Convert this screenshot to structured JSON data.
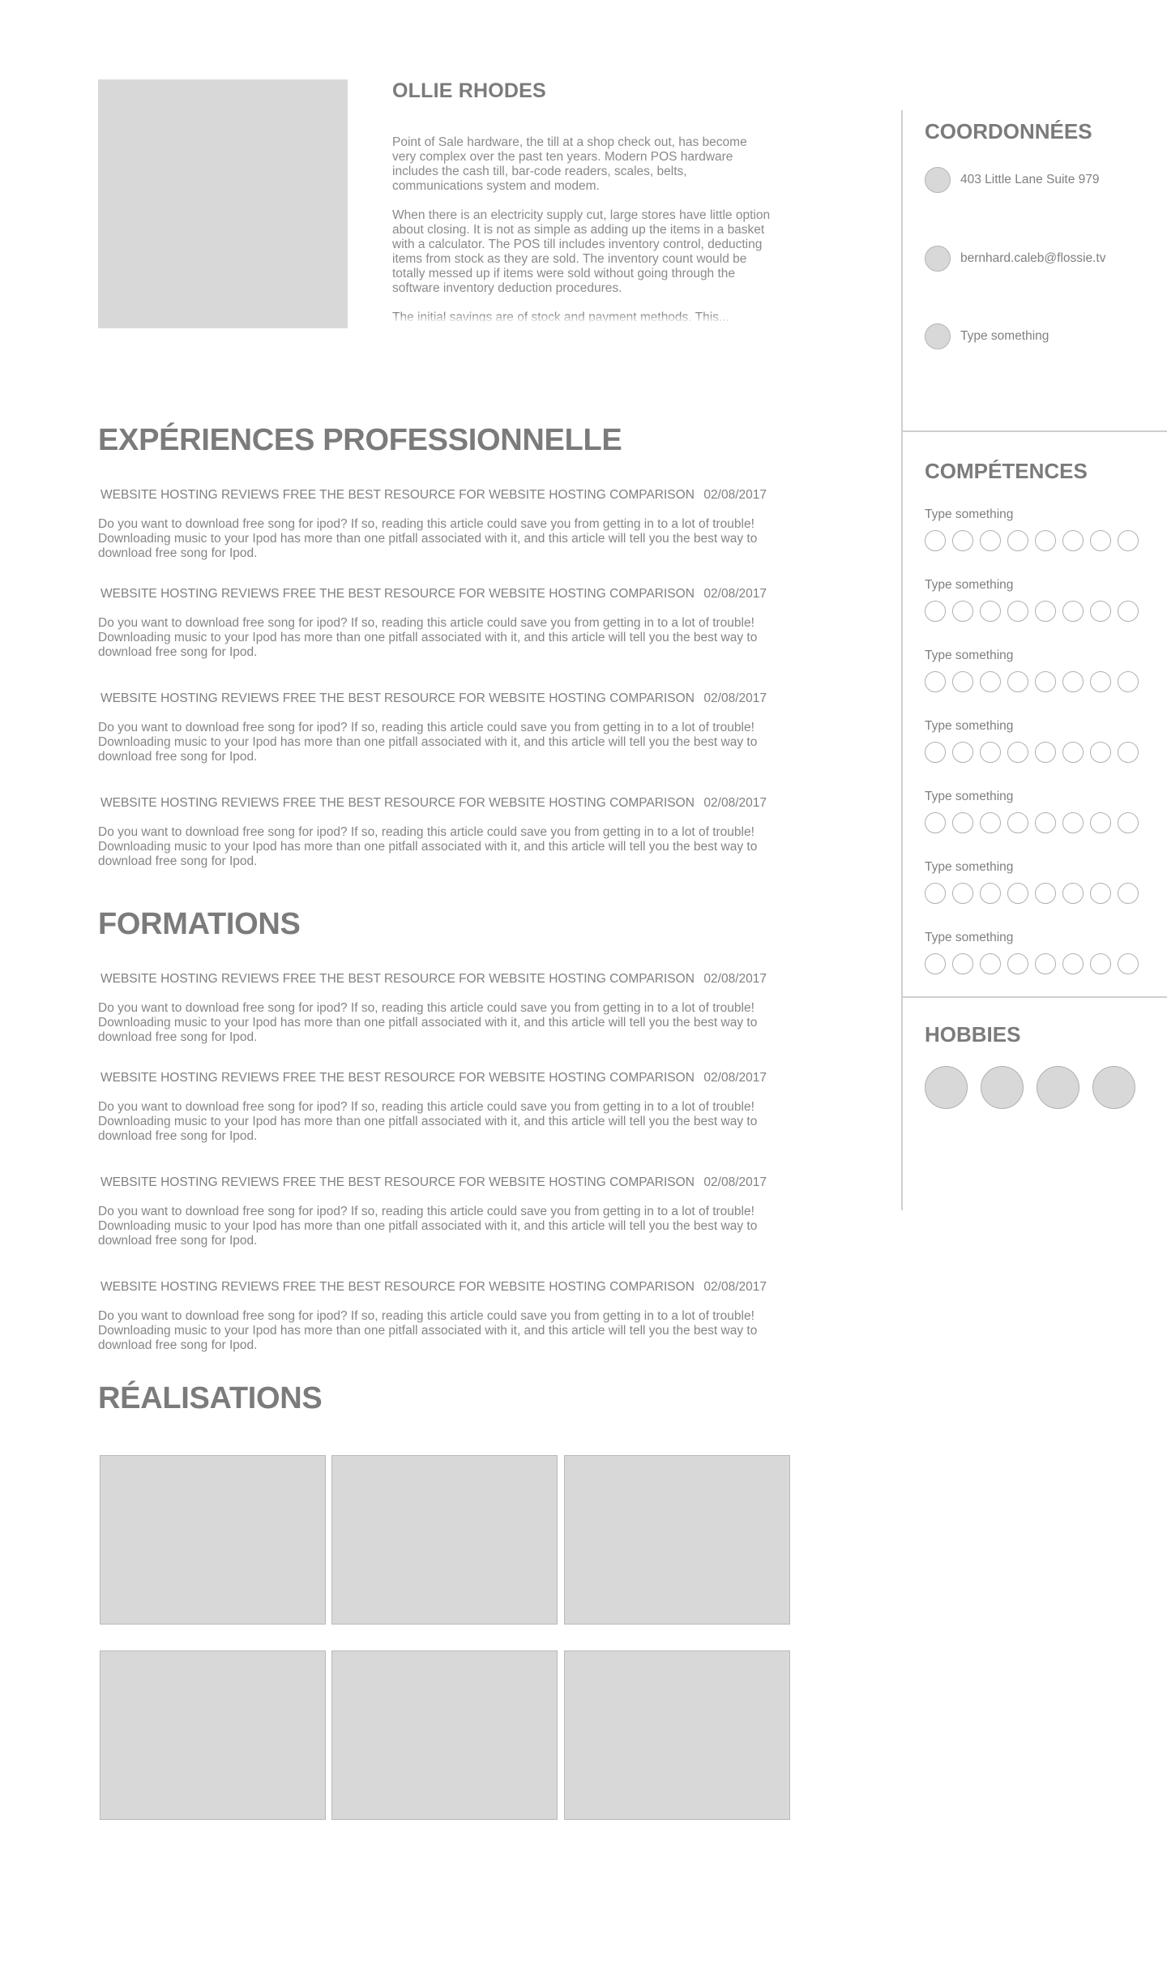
{
  "profile": {
    "name": "OLLIE RHODES",
    "about": [
      "Point of Sale hardware, the till at a shop check out, has become very complex over the past ten years. Modern POS hardware includes the cash till, bar-code readers, scales, belts, communications system and modem.",
      "When there is an electricity supply cut, large stores have little option about closing. It is not as simple as adding up the items in a basket with a calculator. The POS till includes inventory control, deducting items from stock as they are sold. The inventory count would be totally messed up if items were sold without going through the software inventory deduction procedures.",
      "The initial savings are of stock and payment methods. This..."
    ]
  },
  "experience": {
    "title": "EXPÉRIENCES PROFESSIONNELLE",
    "entries": [
      {
        "heading": "WEBSITE HOSTING REVIEWS FREE THE BEST RESOURCE FOR WEBSITE HOSTING COMPARISON",
        "date": "02/08/2017",
        "body": "Do you want to download free song for ipod? If so, reading this article could save you from getting in to a lot of trouble! Downloading music to your Ipod has more than one pitfall associated with it, and this article will tell you the best way to download free song for Ipod."
      },
      {
        "heading": "WEBSITE HOSTING REVIEWS FREE THE BEST RESOURCE FOR WEBSITE HOSTING COMPARISON",
        "date": "02/08/2017",
        "body": "Do you want to download free song for ipod? If so, reading this article could save you from getting in to a lot of trouble! Downloading music to your Ipod has more than one pitfall associated with it, and this article will tell you the best way to download free song for Ipod."
      },
      {
        "heading": "WEBSITE HOSTING REVIEWS FREE THE BEST RESOURCE FOR WEBSITE HOSTING COMPARISON",
        "date": "02/08/2017",
        "body": "Do you want to download free song for ipod? If so, reading this article could save you from getting in to a lot of trouble! Downloading music to your Ipod has more than one pitfall associated with it, and this article will tell you the best way to download free song for Ipod."
      },
      {
        "heading": "WEBSITE HOSTING REVIEWS FREE THE BEST RESOURCE FOR WEBSITE HOSTING COMPARISON",
        "date": "02/08/2017",
        "body": "Do you want to download free song for ipod? If so, reading this article could save you from getting in to a lot of trouble! Downloading music to your Ipod has more than one pitfall associated with it, and this article will tell you the best way to download free song for Ipod."
      }
    ]
  },
  "education": {
    "title": "FORMATIONS",
    "entries": [
      {
        "heading": "WEBSITE HOSTING REVIEWS FREE THE BEST RESOURCE FOR WEBSITE HOSTING COMPARISON",
        "date": "02/08/2017",
        "body": "Do you want to download free song for ipod? If so, reading this article could save you from getting in to a lot of trouble! Downloading music to your Ipod has more than one pitfall associated with it, and this article will tell you the best way to download free song for Ipod."
      },
      {
        "heading": "WEBSITE HOSTING REVIEWS FREE THE BEST RESOURCE FOR WEBSITE HOSTING COMPARISON",
        "date": "02/08/2017",
        "body": "Do you want to download free song for ipod? If so, reading this article could save you from getting in to a lot of trouble! Downloading music to your Ipod has more than one pitfall associated with it, and this article will tell you the best way to download free song for Ipod."
      },
      {
        "heading": "WEBSITE HOSTING REVIEWS FREE THE BEST RESOURCE FOR WEBSITE HOSTING COMPARISON",
        "date": "02/08/2017",
        "body": "Do you want to download free song for ipod? If so, reading this article could save you from getting in to a lot of trouble! Downloading music to your Ipod has more than one pitfall associated with it, and this article will tell you the best way to download free song for Ipod."
      },
      {
        "heading": "WEBSITE HOSTING REVIEWS FREE THE BEST RESOURCE FOR WEBSITE HOSTING COMPARISON",
        "date": "02/08/2017",
        "body": "Do you want to download free song for ipod? If so, reading this article could save you from getting in to a lot of trouble! Downloading music to your Ipod has more than one pitfall associated with it, and this article will tell you the best way to download free song for Ipod."
      }
    ]
  },
  "achievements": {
    "title": "RÉALISATIONS"
  },
  "contact": {
    "title": "COORDONNÉES",
    "address": "403 Little Lane Suite 979",
    "email": "bernhard.caleb@flossie.tv",
    "extra": "Type something"
  },
  "skills": {
    "title": "COMPÉTENCES",
    "items": [
      {
        "label": "Type something"
      },
      {
        "label": "Type something"
      },
      {
        "label": "Type something"
      },
      {
        "label": "Type something"
      },
      {
        "label": "Type something"
      },
      {
        "label": "Type something"
      },
      {
        "label": "Type something"
      }
    ]
  },
  "hobbies": {
    "title": "HOBBIES"
  },
  "colors": {
    "text": "#7b7b7b",
    "placeholder": "#d8d8d8",
    "rule": "#cfcfcf"
  }
}
